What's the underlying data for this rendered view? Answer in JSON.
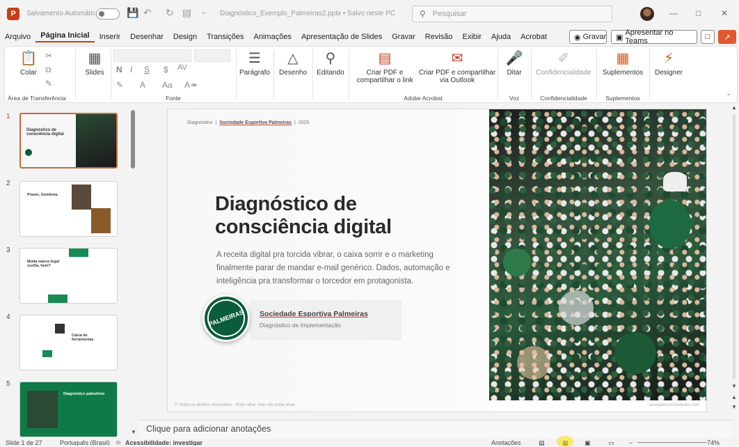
{
  "titlebar": {
    "autosave_label": "Salvamento Automático",
    "document_title": "Diagnóstico_Exemplo_Palmeiras2.pptx • Salvo neste PC",
    "search_placeholder": "Pesquisar",
    "app_letter": "P"
  },
  "menu": [
    "Arquivo",
    "Página Inicial",
    "Inserir",
    "Desenhar",
    "Design",
    "Transições",
    "Animações",
    "Apresentação de Slides",
    "Gravar",
    "Revisão",
    "Exibir",
    "Ajuda",
    "Acrobat"
  ],
  "menu_active": "Página Inicial",
  "record_label": "Gravar",
  "teams_label": "Apresentar no Teams",
  "ribbon": {
    "paste": "Colar",
    "clipboard_group": "Área de Transferência",
    "slides": "Slides",
    "font_group": "Fonte",
    "font_buttons": [
      "N",
      "I",
      "S",
      "$",
      "AV"
    ],
    "paragraph": "Parágrafo",
    "drawing": "Desenho",
    "editing": "Editando",
    "create_pdf": "Criar PDF e compartilhar o link",
    "create_pdf_outlook": "Criar PDF e compartilhar via Outlook",
    "adobe_group": "Adobe Acrobat",
    "dictate": "Ditar",
    "voice_group": "Voz",
    "sensitivity": "Confidencialidade",
    "sensitivity_group": "Confidencialidade",
    "addins": "Suplementos",
    "addins_group": "Suplementos",
    "designer": "Designer"
  },
  "thumbnails": [
    {
      "num": "1",
      "title": "Diagnóstico de consciência digital"
    },
    {
      "num": "2",
      "title": "Prazer, Gombeta."
    },
    {
      "num": "3",
      "title": "Muita marca legal confia, hein?"
    },
    {
      "num": "4",
      "title": "Caixa de ferramentas"
    },
    {
      "num": "5",
      "title": "Diagnóstico palestrino"
    }
  ],
  "slide": {
    "crumb_a": "Diagnóstico",
    "crumb_b": "Sociedade Esportiva Palmeiras",
    "crumb_c": "2025",
    "title": "Diagnóstico de consciência digital",
    "subtitle": "A receita digital pra torcida vibrar, o caixa sorrir e o marketing finalmente parar de mandar e-mail genérico. Dados, automação e inteligência pra transformar o torcedor em protagonista.",
    "club_name": "Sociedade Esportiva Palmeiras",
    "club_sub": "Diagnóstico de Implementação",
    "badge_text": "PALMEIRAS",
    "footer_left": "© Todos os direitos reservados · Pode olhar, mas não pode levar.",
    "footer_right": "sasuopencuriosidades.com"
  },
  "notes_placeholder": "Clique para adicionar anotações",
  "status": {
    "slide_info": "Slide 1 de 27",
    "language": "Português (Brasil)",
    "accessibility": "Acessibilidade: investigar",
    "notes": "Anotações",
    "zoom": "74%"
  },
  "colors": {
    "accent": "#c43e1c",
    "palmeiras_green": "#0b5c3a"
  }
}
